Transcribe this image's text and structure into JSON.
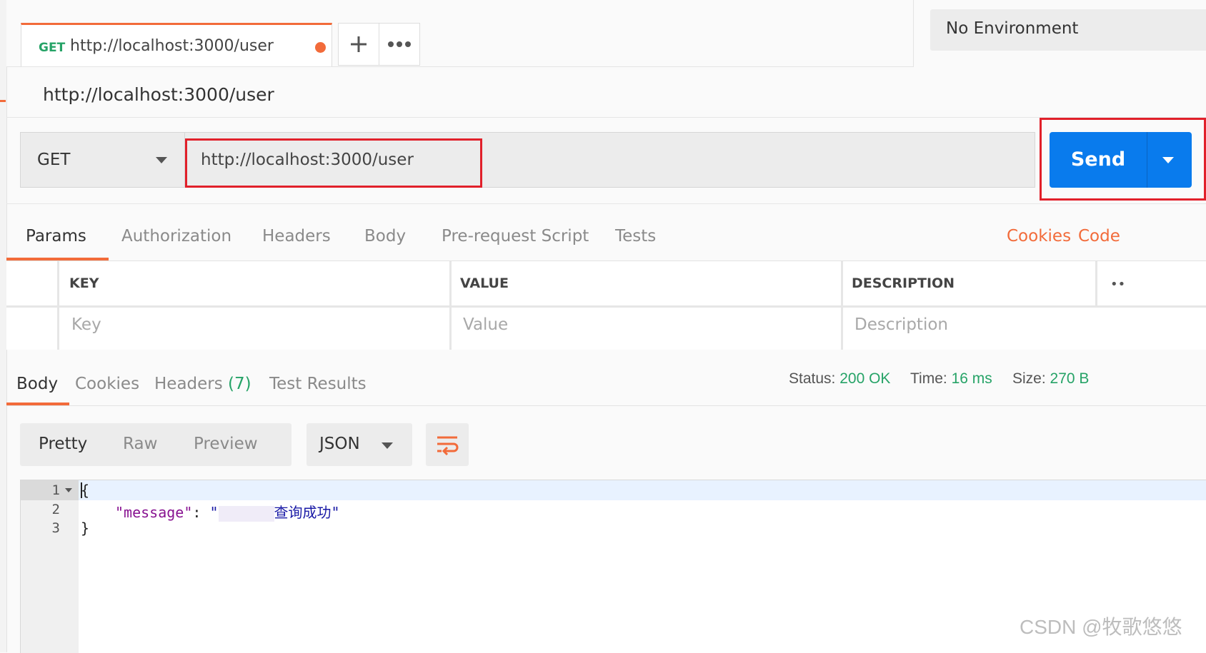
{
  "tab": {
    "method": "GET",
    "url": "http://localhost:3000/user",
    "plus_label": "+",
    "more_label": "•••"
  },
  "environment": {
    "selected": "No Environment"
  },
  "request_title": "http://localhost:3000/user",
  "request": {
    "method": "GET",
    "url": "http://localhost:3000/user",
    "send_label": "Send"
  },
  "request_tabs": [
    "Params",
    "Authorization",
    "Headers",
    "Body",
    "Pre-request Script",
    "Tests"
  ],
  "request_links": {
    "cookies": "Cookies",
    "code": "Code"
  },
  "params_table": {
    "headers": {
      "key": "KEY",
      "value": "VALUE",
      "description": "DESCRIPTION"
    },
    "placeholders": {
      "key": "Key",
      "value": "Value",
      "description": "Description"
    }
  },
  "response_tabs": {
    "body": "Body",
    "cookies": "Cookies",
    "headers": "Headers",
    "headers_count": "(7)",
    "test_results": "Test Results"
  },
  "response_status": {
    "status_label": "Status:",
    "status_value": "200 OK",
    "time_label": "Time:",
    "time_value": "16 ms",
    "size_label": "Size:",
    "size_value": "270 B"
  },
  "response_format": {
    "modes": [
      "Pretty",
      "Raw",
      "Preview"
    ],
    "type": "JSON"
  },
  "response_body": {
    "line_numbers": [
      "1",
      "2",
      "3"
    ],
    "open_brace": "{",
    "key": "\"message\"",
    "colon": ": ",
    "value_quote_open": "\"",
    "value_visible": "查询成功",
    "value_quote_close": "\"",
    "close_brace": "}"
  },
  "watermark": "CSDN @牧歌悠悠",
  "colors": {
    "accent": "#f26b3a",
    "send_blue": "#097bed",
    "success_green": "#26a367",
    "highlight_red": "#e1202a"
  }
}
